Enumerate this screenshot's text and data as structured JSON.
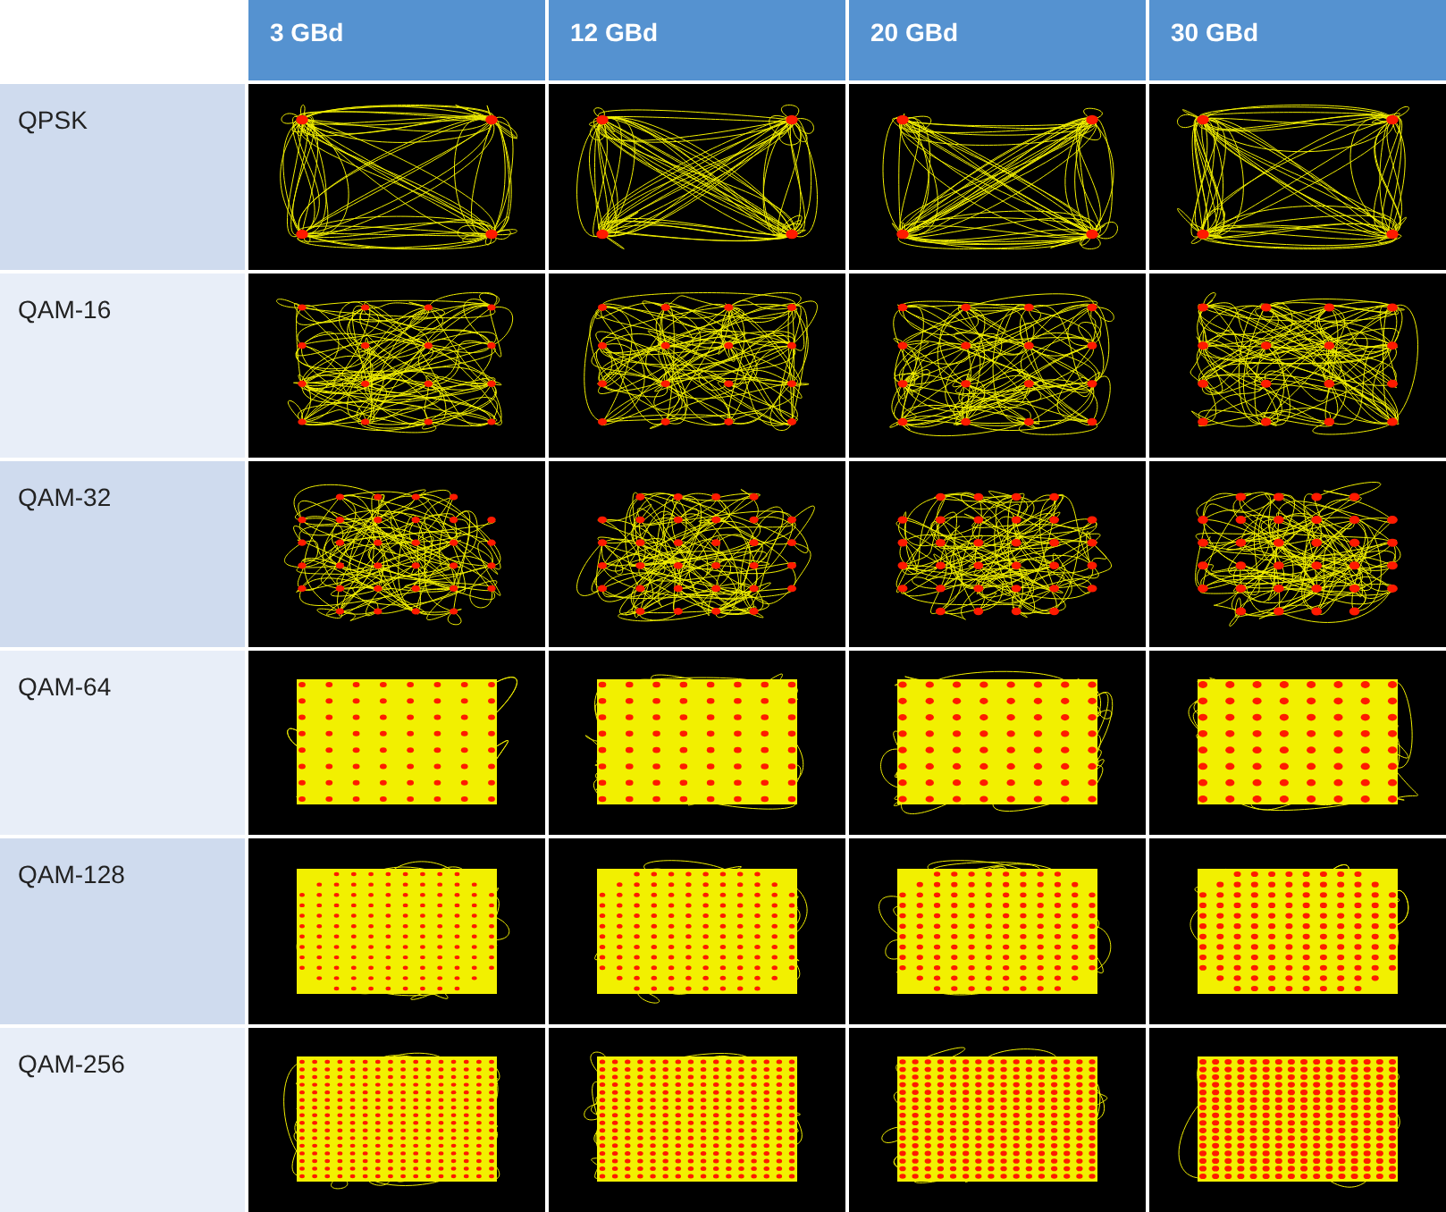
{
  "columns": [
    "3 GBd",
    "12 GBd",
    "20 GBd",
    "30 GBd"
  ],
  "rows": [
    {
      "label": "QPSK",
      "kind": "qpsk"
    },
    {
      "label": "QAM-16",
      "kind": "qam16"
    },
    {
      "label": "QAM-32",
      "kind": "qam32"
    },
    {
      "label": "QAM-64",
      "kind": "qam64"
    },
    {
      "label": "QAM-128",
      "kind": "qam128"
    },
    {
      "label": "QAM-256",
      "kind": "qam256"
    }
  ]
}
